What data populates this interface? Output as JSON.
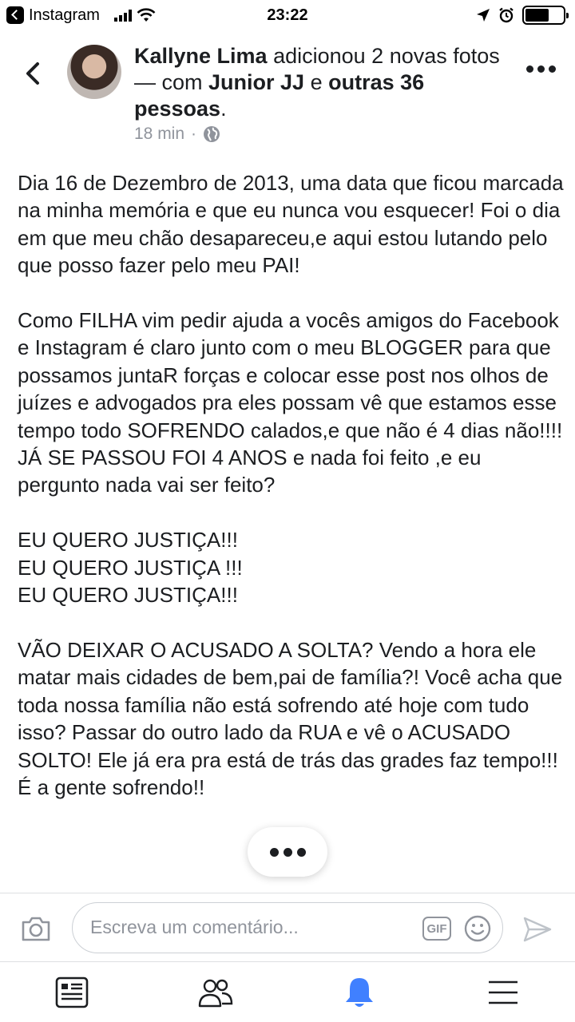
{
  "status_bar": {
    "back_app": "Instagram",
    "time": "23:22",
    "battery_level": 0.62
  },
  "post": {
    "author": "Kallyne Lima",
    "action": "adicionou 2 novas fotos — com",
    "tagged_person": "Junior JJ",
    "connector": "e",
    "others": "outras 36 pessoas",
    "end": ".",
    "time": "18 min",
    "separator": "·",
    "body": "Dia 16 de Dezembro de 2013, uma data que ficou marcada na minha memória e que eu nunca vou esquecer! Foi o dia em que meu chão desapareceu,e aqui estou lutando pelo que posso fazer pelo meu PAI!\n\nComo FILHA vim pedir ajuda a vocês amigos do Facebook e Instagram é claro junto com o meu BLOGGER para que possamos juntaR forças e colocar esse post nos olhos de juízes e advogados pra eles possam vê que estamos esse tempo todo SOFRENDO calados,e que não é 4 dias não!!!!\nJÁ SE PASSOU FOI 4 ANOS e nada foi feito ,e eu pergunto nada vai ser feito?\n\nEU QUERO JUSTIÇA!!!\nEU QUERO JUSTIÇA !!!\nEU QUERO JUSTIÇA!!!\n\nVÃO DEIXAR O ACUSADO A SOLTA? Vendo a hora ele matar mais cidades de bem,pai de família?! Você acha que toda nossa família não está sofrendo até hoje com tudo isso? Passar do outro lado da RUA e vê o ACUSADO SOLTO! Ele já era pra está de trás das grades faz tempo!!! É a gente sofrendo!!"
  },
  "comment_bar": {
    "placeholder": "Escreva um comentário...",
    "gif_label": "GIF"
  },
  "icons": {
    "camera": "camera-icon",
    "emoji": "emoji-icon",
    "send": "send-icon",
    "feed": "news-feed-icon",
    "friends": "friends-icon",
    "notifications": "bell-icon",
    "menu": "menu-icon"
  },
  "colors": {
    "text": "#1c1e21",
    "secondary": "#90949c",
    "active": "#4080ff"
  }
}
